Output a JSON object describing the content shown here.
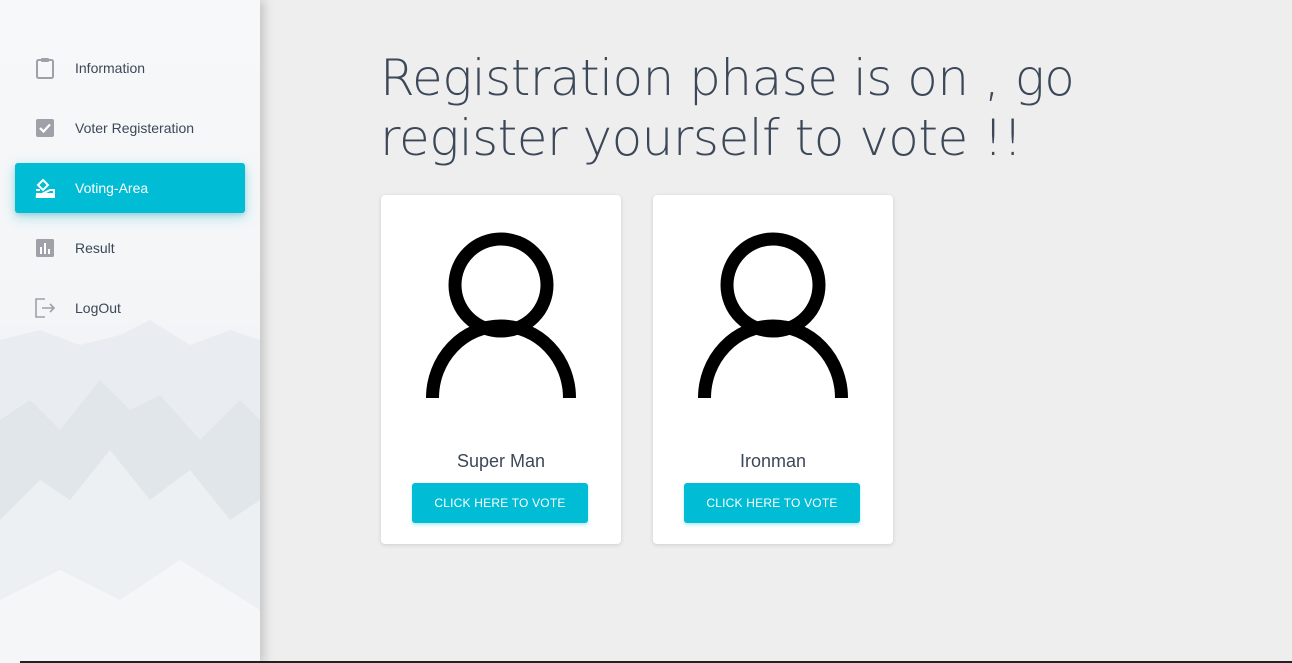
{
  "sidebar": {
    "items": [
      {
        "label": "Information",
        "icon": "clipboard-icon",
        "active": false
      },
      {
        "label": "Voter Registeration",
        "icon": "checkbox-icon",
        "active": false
      },
      {
        "label": "Voting-Area",
        "icon": "ballot-box-icon",
        "active": true
      },
      {
        "label": "Result",
        "icon": "bar-chart-icon",
        "active": false
      },
      {
        "label": "LogOut",
        "icon": "logout-icon",
        "active": false
      }
    ]
  },
  "main": {
    "headline": "Registration phase is on , go register yourself to vote !!",
    "candidates": [
      {
        "name": "Super Man",
        "button_label": "CLICK HERE TO VOTE",
        "icon": "user-avatar-icon"
      },
      {
        "name": "Ironman",
        "button_label": "CLICK HERE TO VOTE",
        "icon": "user-avatar-icon"
      }
    ]
  },
  "colors": {
    "accent": "#00bcd4",
    "text": "#3c4858",
    "background": "#eeeeee",
    "icon_gray": "#9ea2a8"
  }
}
